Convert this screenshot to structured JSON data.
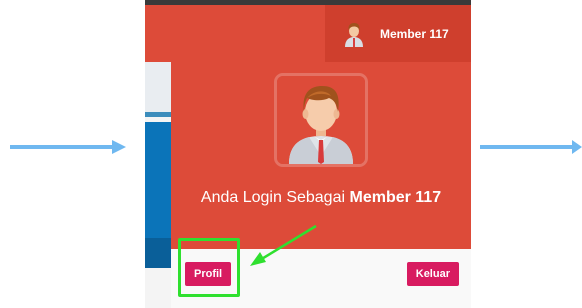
{
  "navbar": {
    "user_name": "Member 117",
    "user_icon": "user-avatar-icon"
  },
  "dropdown": {
    "login_prefix": "Anda Login Sebagai",
    "login_name": "Member 117",
    "profil_label": "Profil",
    "keluar_label": "Keluar"
  },
  "annotations": {
    "arrow_color": "#6fb8f0",
    "highlight_color": "#2fe02f"
  },
  "colors": {
    "header": "#dd4b39",
    "button": "#d81b60",
    "sidebar_blue": "#0b74b9"
  }
}
